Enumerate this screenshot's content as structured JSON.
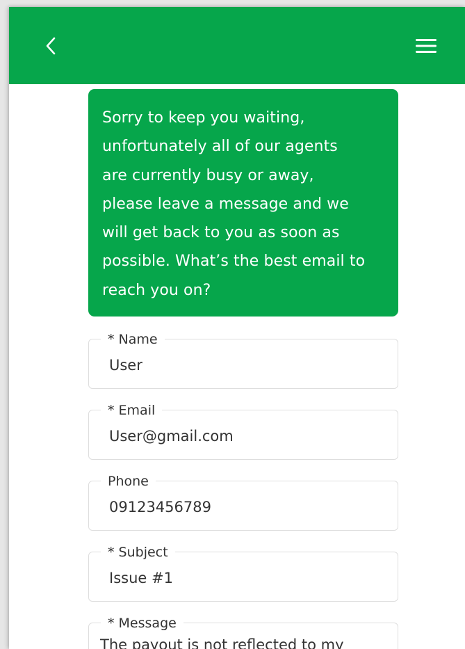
{
  "header": {
    "back_icon": "chevron-left-icon",
    "menu_icon": "hamburger-menu-icon",
    "color": "#06a64b"
  },
  "chat": {
    "bot_message_lines": [
      "Sorry to keep you waiting,",
      "unfortunately all of our agents",
      "are currently busy or away,",
      "please leave a message and we",
      "will get back to you as soon as",
      "possible. What’s the best email to",
      "reach you on?"
    ],
    "bubble_color": "#06a64b"
  },
  "form": {
    "name": {
      "label": "* Name",
      "value": "User"
    },
    "email": {
      "label": "* Email",
      "value": "User@gmail.com"
    },
    "phone": {
      "label": "Phone",
      "value": "09123456789"
    },
    "subject": {
      "label": "* Subject",
      "value": "Issue #1"
    },
    "message": {
      "label": "* Message",
      "value": "The payout is not reflected to my"
    }
  }
}
